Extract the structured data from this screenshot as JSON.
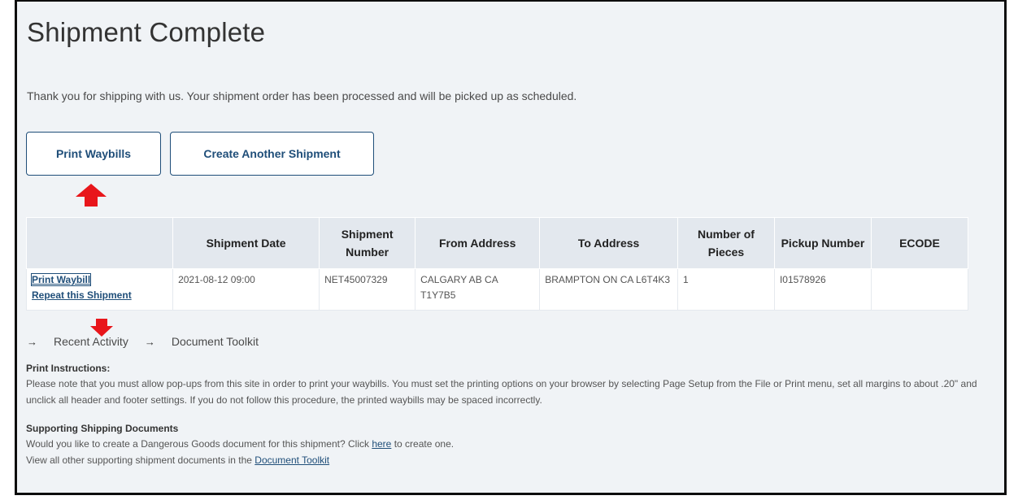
{
  "page": {
    "title": "Shipment Complete",
    "thanks": "Thank you for shipping with us. Your shipment order has been processed and will be picked up as scheduled."
  },
  "actions": {
    "print_waybills": "Print Waybills",
    "create_another": "Create Another Shipment"
  },
  "table": {
    "headers": [
      "",
      "Shipment Date",
      "Shipment Number",
      "From Address",
      "To Address",
      "Number of Pieces",
      "Pickup Number",
      "ECODE"
    ],
    "rows": [
      {
        "print_waybill": "Print Waybill",
        "repeat": "Repeat this Shipment",
        "date": "2021-08-12 09:00",
        "number": "NET45007329",
        "from": "CALGARY AB CA T1Y7B5",
        "to": "BRAMPTON ON CA L6T4K3",
        "pieces": "1",
        "pickup": "I01578926",
        "ecode": ""
      }
    ]
  },
  "quick_links": [
    {
      "label": "Recent Activity",
      "icon": "arrow-right-icon"
    },
    {
      "label": "Document Toolkit",
      "icon": "arrow-right-icon"
    }
  ],
  "print_instructions": {
    "heading": "Print Instructions:",
    "text": "Please note that you must allow pop-ups from this site in order to print your waybills. You must set the printing options on your browser by selecting Page Setup from the File or Print menu, set all margins to about .20\" and unclick all header and footer settings. If you do not follow this procedure, the printed waybills may be spaced incorrectly."
  },
  "supporting": {
    "heading": "Supporting Shipping Documents",
    "dg_prefix": "Would you like to create a Dangerous Goods document for this shipment? Click ",
    "dg_link": "here",
    "dg_suffix": " to create one.",
    "toolkit_prefix": "View all other supporting shipment documents in the ",
    "toolkit_link": "Document Toolkit"
  },
  "annotations": {
    "color": "#e8161b",
    "up_arrow_icon": "arrow-up-icon",
    "down_arrow_icon": "arrow-down-icon"
  }
}
